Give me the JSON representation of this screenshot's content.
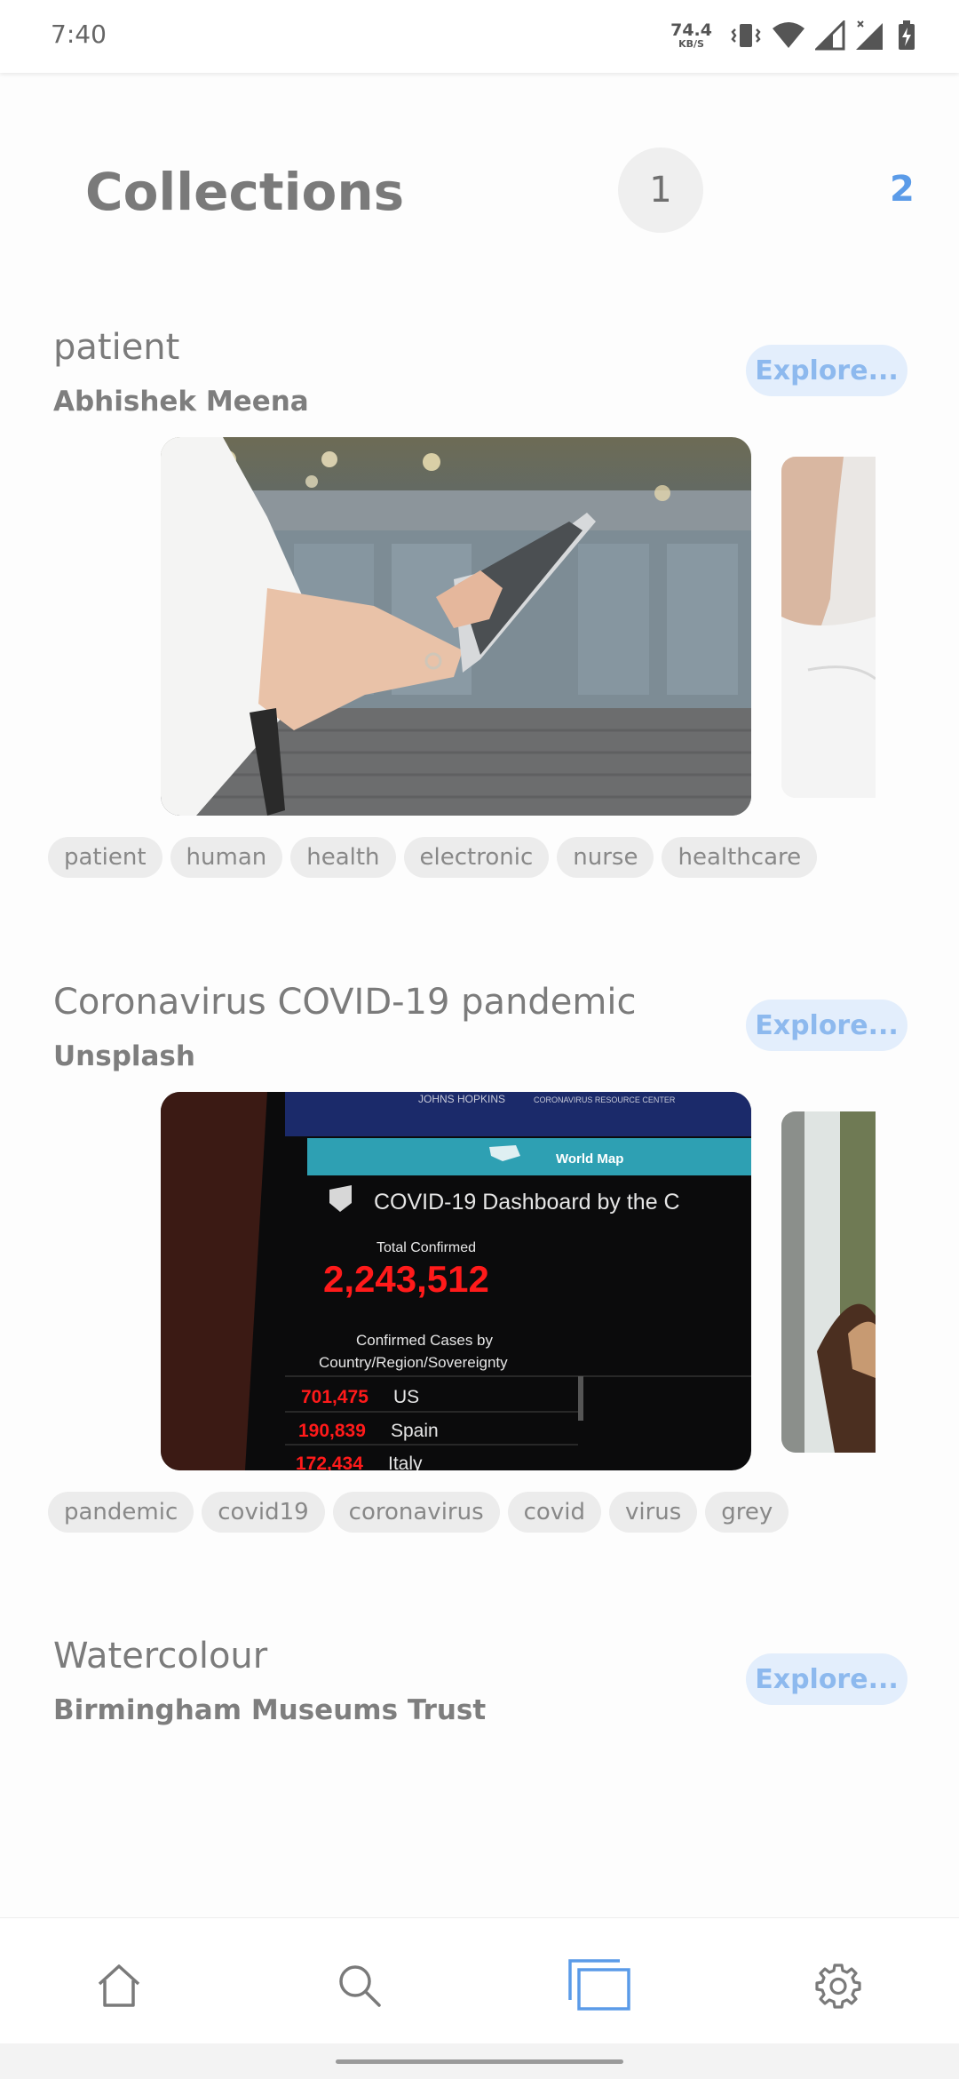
{
  "status_bar": {
    "time": "7:40",
    "net_speed_value": "74.4",
    "net_speed_unit": "KB/S",
    "icons": [
      "vibrate-icon",
      "wifi-icon",
      "signal-icon",
      "signal-no-data-icon",
      "battery-charging-icon"
    ]
  },
  "header": {
    "title": "Collections",
    "pages": [
      "1",
      "2"
    ],
    "active_page": "1"
  },
  "collections": [
    {
      "title": "patient",
      "author": "Abhishek Meena",
      "explore_label": "Explore...",
      "tags": [
        "patient",
        "human",
        "health",
        "electronic",
        "nurse",
        "healthcare"
      ]
    },
    {
      "title": "Coronavirus COVID-19 pandemic",
      "author": "Unsplash",
      "explore_label": "Explore...",
      "tags": [
        "pandemic",
        "covid19",
        "coronavirus",
        "covid",
        "virus",
        "grey"
      ],
      "photo_text": {
        "header": "JOHNS HOPKINS",
        "header_right": "CORONAVIRUS RESOURCE CENTER",
        "map_label": "World Map",
        "dashboard_title": "COVID-19 Dashboard by the C",
        "total_label": "Total Confirmed",
        "total_value": "2,243,512",
        "cases_label_1": "Confirmed Cases by",
        "cases_label_2": "Country/Region/Sovereignty",
        "rows": [
          {
            "value": "701,475",
            "country": "US"
          },
          {
            "value": "190,839",
            "country": "Spain"
          },
          {
            "value": "172,434",
            "country": "Italy"
          }
        ]
      }
    },
    {
      "title": "Watercolour",
      "author": "Birmingham Museums Trust",
      "explore_label": "Explore..."
    }
  ],
  "bottom_nav": {
    "items": [
      "home-icon",
      "search-icon",
      "collections-icon",
      "settings-icon"
    ],
    "active": "collections-icon",
    "colors": {
      "active": "#5b9be8",
      "inactive": "#7a7a7a"
    }
  }
}
